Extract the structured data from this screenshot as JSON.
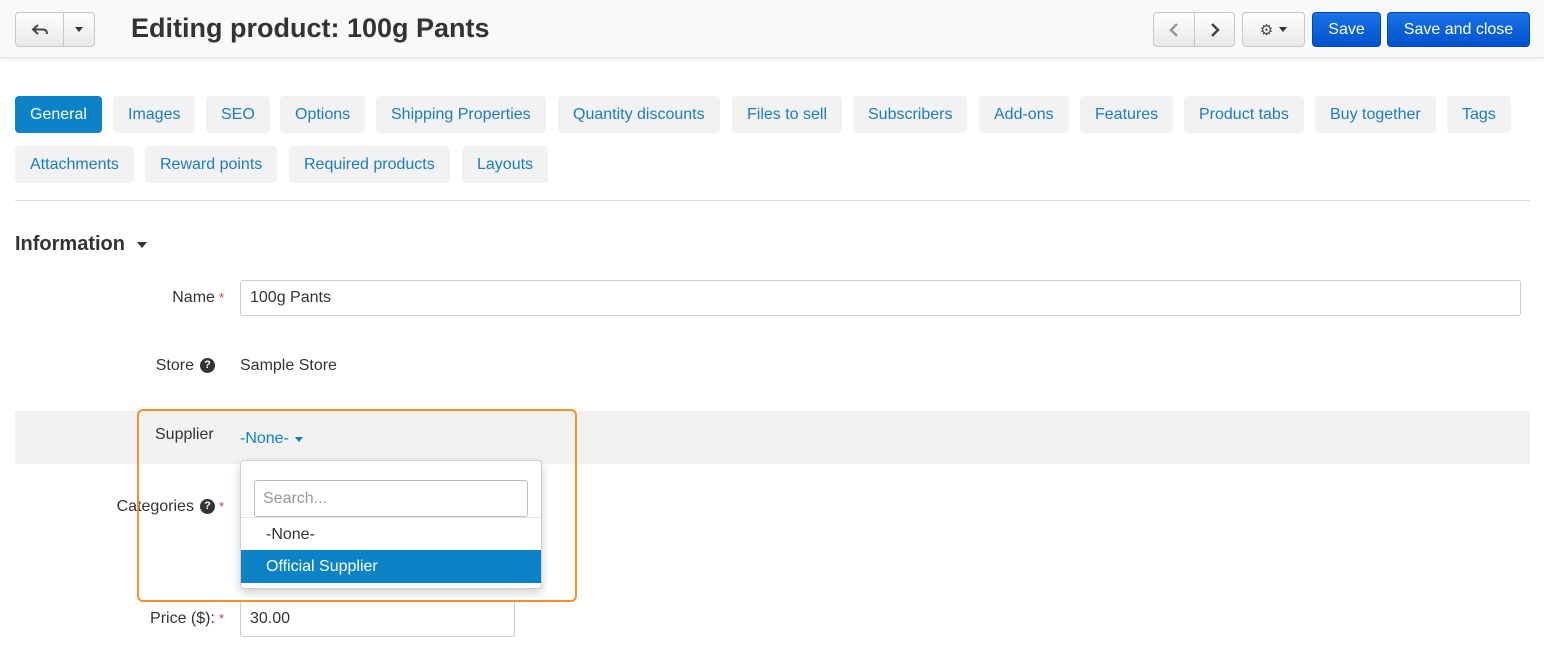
{
  "header": {
    "title": "Editing product: 100g Pants",
    "save_label": "Save",
    "save_close_label": "Save and close"
  },
  "tabs": [
    {
      "label": "General",
      "active": true
    },
    {
      "label": "Images"
    },
    {
      "label": "SEO"
    },
    {
      "label": "Options"
    },
    {
      "label": "Shipping Properties"
    },
    {
      "label": "Quantity discounts"
    },
    {
      "label": "Files to sell"
    },
    {
      "label": "Subscribers"
    },
    {
      "label": "Add-ons"
    },
    {
      "label": "Features"
    },
    {
      "label": "Product tabs"
    },
    {
      "label": "Buy together"
    },
    {
      "label": "Tags"
    },
    {
      "label": "Attachments"
    },
    {
      "label": "Reward points"
    },
    {
      "label": "Required products"
    },
    {
      "label": "Layouts"
    }
  ],
  "section": {
    "title": "Information"
  },
  "form": {
    "name_label": "Name",
    "name_value": "100g Pants",
    "store_label": "Store",
    "store_value": "Sample Store",
    "supplier_label": "Supplier",
    "supplier_value": "-None-",
    "categories_label": "Categories",
    "price_label": "Price ($):",
    "price_value": "30.00",
    "required_mark": "*",
    "help_mark": "?"
  },
  "supplier_dropdown": {
    "search_placeholder": "Search...",
    "options": [
      "-None-",
      "Official Supplier"
    ],
    "highlighted": "Official Supplier"
  },
  "colors": {
    "accent": "#0b83c6",
    "primary_button": "#0052cc",
    "highlight_outline": "#f0932b",
    "required": "#d63b3b"
  }
}
